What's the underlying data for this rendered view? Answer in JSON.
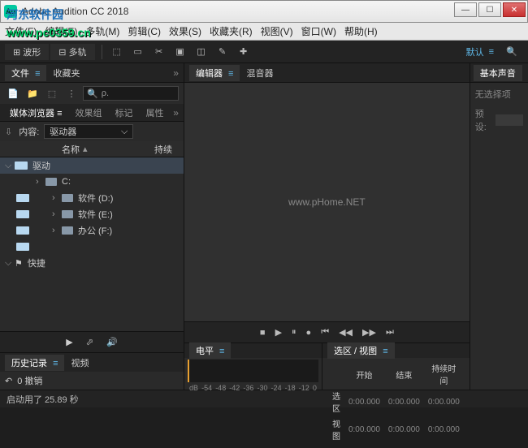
{
  "window": {
    "title": "Adobe Audition CC 2018",
    "app_icon_text": "Au"
  },
  "menu": [
    "文件(F)",
    "编辑(E)",
    "多轨(M)",
    "剪辑(C)",
    "效果(S)",
    "收藏夹(R)",
    "视图(V)",
    "窗口(W)",
    "帮助(H)"
  ],
  "toolbar": {
    "tabs": [
      "波形",
      "多轨"
    ],
    "workspace_label": "默认"
  },
  "left": {
    "files_tab": "文件",
    "fav_tab": "收藏夹",
    "search_placeholder": "ρ.",
    "browser_tabs": [
      "媒体浏览器",
      "效果组",
      "标记",
      "属性"
    ],
    "content_label": "内容:",
    "content_value": "驱动器",
    "col_name": "名称",
    "col_dur": "持续",
    "tree": {
      "root": "驱动",
      "drives": [
        "C:",
        "软件 (D:)",
        "软件 (E:)",
        "办公 (F:)"
      ],
      "shortcut": "快捷"
    },
    "history_tab": "历史记录",
    "video_tab": "视频",
    "undo_label": "0 撤销"
  },
  "right": {
    "editor_tab": "编辑器",
    "mixer_tab": "混音器",
    "watermark": "www.pHome.NET",
    "wm2": "www.pc0359.cn",
    "wm3": "河东软件园"
  },
  "rfar": {
    "title": "基本声音",
    "nosel": "无选择项",
    "preset_label": "预设:"
  },
  "level": {
    "title": "电平",
    "scale": [
      "dB",
      "-54",
      "-48",
      "-42",
      "-36",
      "-30",
      "-24",
      "-18",
      "-12",
      "0"
    ]
  },
  "selection": {
    "title": "选区 / 视图",
    "cols": [
      "开始",
      "结束",
      "持续时间"
    ],
    "rows": [
      "选区",
      "视图"
    ],
    "zero": "0:00.000"
  },
  "status": "启动用了 25.89 秒"
}
